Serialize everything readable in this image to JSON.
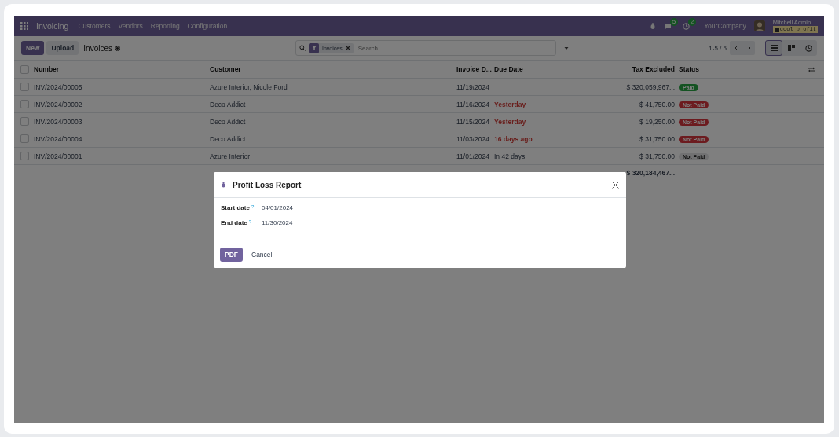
{
  "navbar": {
    "app_name": "Invoicing",
    "menu": [
      "Customers",
      "Vendors",
      "Reporting",
      "Configuration"
    ],
    "messages_count": "5",
    "activities_count": "2",
    "company": "YourCompany",
    "user": "Mitchell Admin",
    "database": "cool_profit"
  },
  "control_panel": {
    "new_button": "New",
    "upload_button": "Upload",
    "breadcrumb": "Invoices",
    "search": {
      "facet": "Invoices",
      "placeholder": "Search..."
    },
    "pager": "1-5 / 5",
    "views": [
      {
        "kind": "list",
        "selected": true
      },
      {
        "kind": "kanban",
        "selected": false
      },
      {
        "kind": "activity",
        "selected": false
      }
    ]
  },
  "table": {
    "all_checked": false,
    "columns": [
      "Number",
      "Customer",
      "Invoice D...",
      "Due Date",
      "Tax Excluded",
      "Status"
    ],
    "rows": [
      {
        "checked": false,
        "number": "INV/2024/00005",
        "customer": "Azure Interior, Nicole Ford",
        "invoice_date": "11/19/2024",
        "tax_excluded": "$ 320,059,967...",
        "status": {
          "label": "Paid",
          "kind": "paid"
        }
      },
      {
        "checked": false,
        "number": "INV/2024/00002",
        "customer": "Deco Addict",
        "invoice_date": "11/16/2024",
        "due_date": "Yesterday",
        "overdue": true,
        "tax_excluded": "$ 41,750.00",
        "status": {
          "label": "Not Paid",
          "kind": "overdue"
        }
      },
      {
        "checked": false,
        "number": "INV/2024/00003",
        "customer": "Deco Addict",
        "invoice_date": "11/15/2024",
        "due_date": "Yesterday",
        "overdue": true,
        "tax_excluded": "$ 19,250.00",
        "status": {
          "label": "Not Paid",
          "kind": "overdue"
        }
      },
      {
        "checked": false,
        "number": "INV/2024/00004",
        "customer": "Deco Addict",
        "invoice_date": "11/03/2024",
        "due_date": "16 days ago",
        "overdue": true,
        "tax_excluded": "$ 31,750.00",
        "status": {
          "label": "Not Paid",
          "kind": "overdue"
        }
      },
      {
        "checked": false,
        "number": "INV/2024/00001",
        "customer": "Azure Interior",
        "invoice_date": "11/01/2024",
        "due_date": "In 42 days",
        "overdue": false,
        "tax_excluded": "$ 31,750.00",
        "status": {
          "label": "Not Paid",
          "kind": "open"
        }
      }
    ],
    "total": "$ 320,184,467..."
  },
  "dialog": {
    "title": "Profit Loss Report",
    "fields": [
      {
        "label": "Start date",
        "help": "?",
        "value": "04/01/2024"
      },
      {
        "label": "End date",
        "help": "?",
        "value": "11/30/2024"
      }
    ],
    "primary_button": "PDF",
    "secondary_button": "Cancel"
  }
}
